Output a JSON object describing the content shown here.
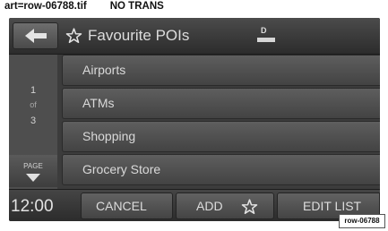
{
  "document": {
    "file_label": "art=row-06788.tif",
    "trans_label": "NO TRANS",
    "art_id": "row-06788"
  },
  "header": {
    "back_icon": "left-arrow-icon",
    "favourite_icon": "star-outline-icon",
    "title": "Favourite POIs",
    "mode_letter": "D",
    "mode_icon": "display-mode-icon"
  },
  "pager": {
    "current": "1",
    "of": "of",
    "total": "3",
    "page_label": "PAGE",
    "page_icon": "down-arrow-icon"
  },
  "list": {
    "items": [
      {
        "label": "Airports"
      },
      {
        "label": "ATMs"
      },
      {
        "label": "Shopping"
      },
      {
        "label": "Grocery Store"
      }
    ]
  },
  "bottom": {
    "clock": "12:00",
    "cancel_label": "CANCEL",
    "add_label": "ADD",
    "add_icon": "star-outline-icon",
    "edit_label": "EDIT LIST"
  },
  "colors": {
    "screen_bg": "#3c3c3c",
    "button_bg": "#555555",
    "text": "#dcdcdc"
  }
}
